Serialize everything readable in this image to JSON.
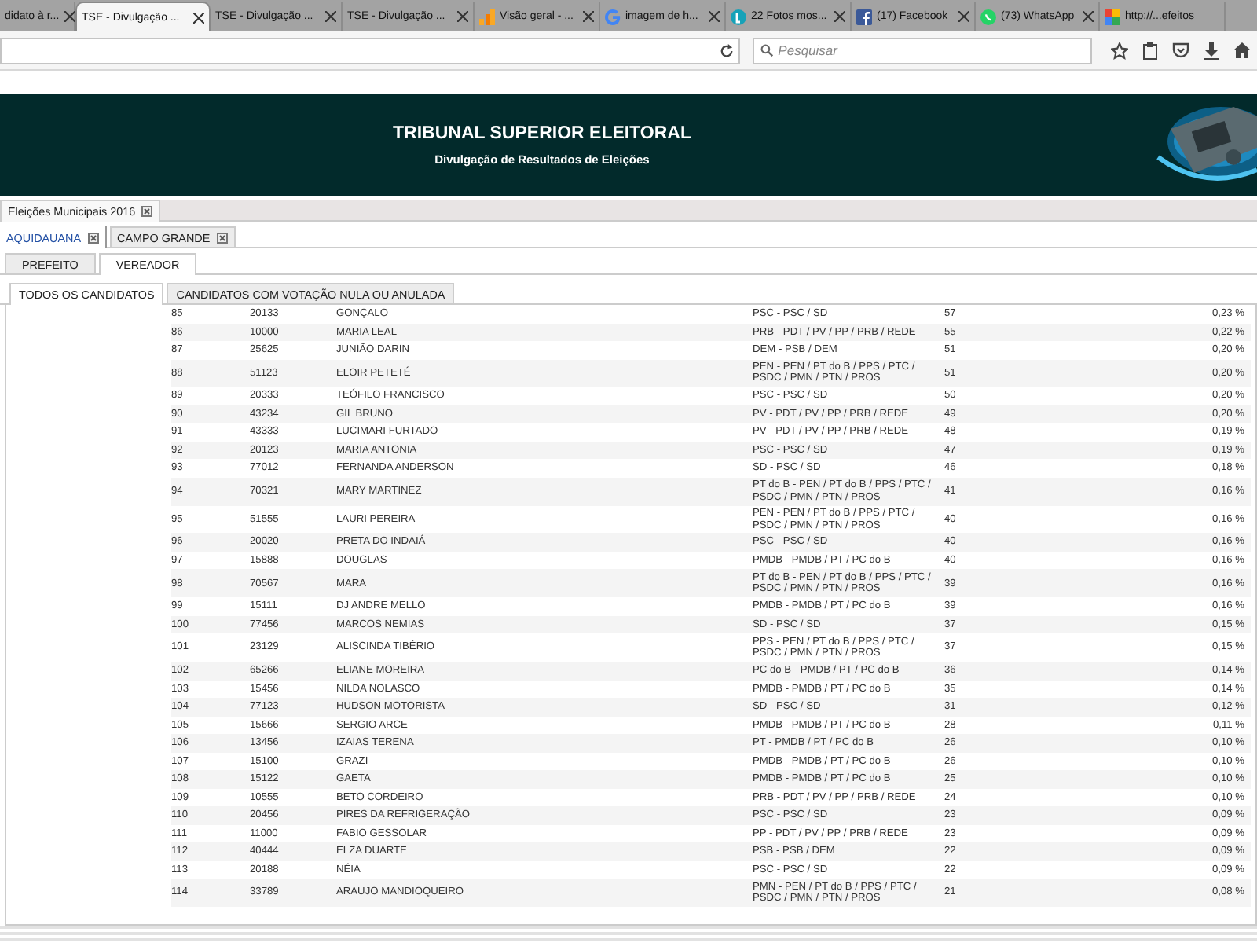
{
  "browser": {
    "tabs": [
      {
        "title": "didato à r...",
        "selected": false
      },
      {
        "title": "TSE - Divulgação ...",
        "selected": true
      },
      {
        "title": "TSE - Divulgação ...",
        "selected": false
      },
      {
        "title": "TSE - Divulgação ...",
        "selected": false
      },
      {
        "title": "Visão geral - ...",
        "selected": false
      },
      {
        "title": "imagem de h...",
        "selected": false
      },
      {
        "title": "22 Fotos mos...",
        "selected": false
      },
      {
        "title": "(17) Facebook",
        "selected": false
      },
      {
        "title": "(73) WhatsApp",
        "selected": false
      },
      {
        "title": "http://...efeitos",
        "selected": false
      }
    ],
    "search": {
      "placeholder": "Pesquisar"
    }
  },
  "header": {
    "title": "TRIBUNAL SUPERIOR ELEITORAL",
    "subtitle": "Divulgação de Resultados de Eleições"
  },
  "election_tabs": [
    {
      "label": "Eleições Municipais 2016",
      "selected": true
    }
  ],
  "city_tabs": [
    {
      "label": "AQUIDAUANA",
      "selected": true
    },
    {
      "label": "CAMPO GRANDE",
      "selected": false
    }
  ],
  "office_tabs": [
    {
      "label": "PREFEITO",
      "selected": false
    },
    {
      "label": "VEREADOR",
      "selected": true
    }
  ],
  "filter_tabs": [
    {
      "label": "TODOS OS CANDIDATOS",
      "selected": true
    },
    {
      "label": "CANDIDATOS COM VOTAÇÃO NULA OU ANULADA",
      "selected": false
    }
  ],
  "table": {
    "rows": [
      [
        "85",
        "20133",
        "GONÇALO",
        "PSC - PSC / SD",
        "57",
        "0,23 %"
      ],
      [
        "86",
        "10000",
        "MARIA LEAL",
        "PRB - PDT / PV / PP / PRB / REDE",
        "55",
        "0,22 %"
      ],
      [
        "87",
        "25625",
        "JUNIÃO DARIN",
        "DEM - PSB / DEM",
        "51",
        "0,20 %"
      ],
      [
        "88",
        "51123",
        "ELOIR PETETÉ",
        "PEN - PEN / PT do B / PPS / PTC / PSDC / PMN / PTN / PROS",
        "51",
        "0,20 %"
      ],
      [
        "89",
        "20333",
        "TEÓFILO FRANCISCO",
        "PSC - PSC / SD",
        "50",
        "0,20 %"
      ],
      [
        "90",
        "43234",
        "GIL BRUNO",
        "PV - PDT / PV / PP / PRB / REDE",
        "49",
        "0,20 %"
      ],
      [
        "91",
        "43333",
        "LUCIMARI FURTADO",
        "PV - PDT / PV / PP / PRB / REDE",
        "48",
        "0,19 %"
      ],
      [
        "92",
        "20123",
        "MARIA ANTONIA",
        "PSC - PSC / SD",
        "47",
        "0,19 %"
      ],
      [
        "93",
        "77012",
        "FERNANDA ANDERSON",
        "SD - PSC / SD",
        "46",
        "0,18 %"
      ],
      [
        "94",
        "70321",
        "MARY MARTINEZ",
        "PT do B - PEN / PT do B / PPS / PTC / PSDC / PMN / PTN / PROS",
        "41",
        "0,16 %"
      ],
      [
        "95",
        "51555",
        "LAURI PEREIRA",
        "PEN - PEN / PT do B / PPS / PTC / PSDC / PMN / PTN / PROS",
        "40",
        "0,16 %"
      ],
      [
        "96",
        "20020",
        "PRETA DO INDAIÁ",
        "PSC - PSC / SD",
        "40",
        "0,16 %"
      ],
      [
        "97",
        "15888",
        "DOUGLAS",
        "PMDB - PMDB / PT / PC do B",
        "40",
        "0,16 %"
      ],
      [
        "98",
        "70567",
        "MARA",
        "PT do B - PEN / PT do B / PPS / PTC / PSDC / PMN / PTN / PROS",
        "39",
        "0,16 %"
      ],
      [
        "99",
        "15111",
        "DJ ANDRE MELLO",
        "PMDB - PMDB / PT / PC do B",
        "39",
        "0,16 %"
      ],
      [
        "100",
        "77456",
        "MARCOS NEMIAS",
        "SD - PSC / SD",
        "37",
        "0,15 %"
      ],
      [
        "101",
        "23129",
        "ALISCINDA TIBÉRIO",
        "PPS - PEN / PT do B / PPS / PTC / PSDC / PMN / PTN / PROS",
        "37",
        "0,15 %"
      ],
      [
        "102",
        "65266",
        "ELIANE MOREIRA",
        "PC do B - PMDB / PT / PC do B",
        "36",
        "0,14 %"
      ],
      [
        "103",
        "15456",
        "NILDA NOLASCO",
        "PMDB - PMDB / PT / PC do B",
        "35",
        "0,14 %"
      ],
      [
        "104",
        "77123",
        "HUDSON MOTORISTA",
        "SD - PSC / SD",
        "31",
        "0,12 %"
      ],
      [
        "105",
        "15666",
        "SERGIO ARCE",
        "PMDB - PMDB / PT / PC do B",
        "28",
        "0,11 %"
      ],
      [
        "106",
        "13456",
        "IZAIAS TERENA",
        "PT - PMDB / PT / PC do B",
        "26",
        "0,10 %"
      ],
      [
        "107",
        "15100",
        "GRAZI",
        "PMDB - PMDB / PT / PC do B",
        "26",
        "0,10 %"
      ],
      [
        "108",
        "15122",
        "GAETA",
        "PMDB - PMDB / PT / PC do B",
        "25",
        "0,10 %"
      ],
      [
        "109",
        "10555",
        "BETO CORDEIRO",
        "PRB - PDT / PV / PP / PRB / REDE",
        "24",
        "0,10 %"
      ],
      [
        "110",
        "20456",
        "PIRES DA REFRIGERAÇÃO",
        "PSC - PSC / SD",
        "23",
        "0,09 %"
      ],
      [
        "111",
        "11000",
        "FABIO GESSOLAR",
        "PP - PDT / PV / PP / PRB / REDE",
        "23",
        "0,09 %"
      ],
      [
        "112",
        "40444",
        "ELZA DUARTE",
        "PSB - PSB / DEM",
        "22",
        "0,09 %"
      ],
      [
        "113",
        "20188",
        "NÉIA",
        "PSC - PSC / SD",
        "22",
        "0,09 %"
      ],
      [
        "114",
        "33789",
        "ARAUJO MANDIOQUEIRO",
        "PMN - PEN / PT do B / PPS / PTC / PSDC / PMN / PTN / PROS",
        "21",
        "0,08 %"
      ]
    ]
  }
}
